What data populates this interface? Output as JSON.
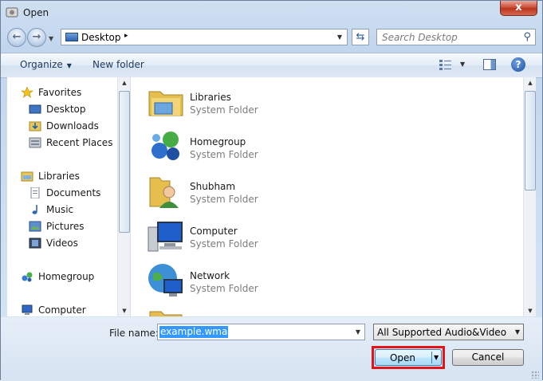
{
  "window": {
    "title": "Open",
    "close_label": "x"
  },
  "address": {
    "location": "Desktop",
    "separator": "▸"
  },
  "search": {
    "placeholder": "Search Desktop"
  },
  "toolbar": {
    "organize_label": "Organize",
    "new_folder_label": "New folder",
    "help_label": "?"
  },
  "navigation": {
    "groups": [
      {
        "label": "Favorites",
        "items": [
          "Desktop",
          "Downloads",
          "Recent Places"
        ]
      },
      {
        "label": "Libraries",
        "items": [
          "Documents",
          "Music",
          "Pictures",
          "Videos"
        ]
      },
      {
        "label": "Homegroup",
        "items": []
      },
      {
        "label": "Computer",
        "items": []
      }
    ]
  },
  "content": {
    "items": [
      {
        "name": "Libraries",
        "type": "System Folder",
        "icon": "libraries-icon"
      },
      {
        "name": "Homegroup",
        "type": "System Folder",
        "icon": "homegroup-icon"
      },
      {
        "name": "Shubham",
        "type": "System Folder",
        "icon": "user-folder-icon"
      },
      {
        "name": "Computer",
        "type": "System Folder",
        "icon": "computer-icon"
      },
      {
        "name": "Network",
        "type": "System Folder",
        "icon": "network-icon"
      }
    ]
  },
  "footer": {
    "file_name_label": "File name:",
    "file_name_value": "example.wma",
    "file_type_filter": "All Supported Audio&Video Files",
    "open_label": "Open",
    "cancel_label": "Cancel"
  },
  "colors": {
    "highlight_border": "#e0141b",
    "selection": "#3399ff",
    "link_text": "#1e395b"
  }
}
